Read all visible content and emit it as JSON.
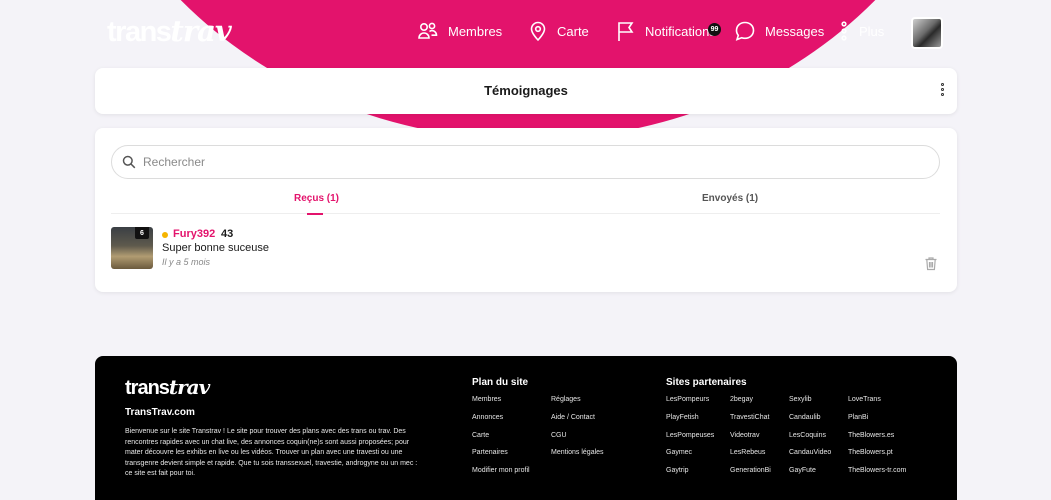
{
  "header": {
    "logo_a": "trans",
    "logo_b": "trav",
    "nav": {
      "members": "Membres",
      "map": "Carte",
      "notifications": "Notifications",
      "notifications_badge": "99",
      "messages": "Messages",
      "more": "Plus"
    }
  },
  "page": {
    "title": "Témoignages"
  },
  "search": {
    "placeholder": "Rechercher"
  },
  "tabs": {
    "received": "Reçus (1)",
    "sent": "Envoyés (1)"
  },
  "testimonial": {
    "photo_count": "6",
    "username": "Fury392",
    "age": "43",
    "message": "Super bonne suceuse",
    "time": "Il y a 5 mois",
    "status_color": "#f5b400"
  },
  "footer": {
    "logo_a": "trans",
    "logo_b": "trav",
    "site_name": "TransTrav.com",
    "description": "Bienvenue sur le site Transtrav ! Le site pour trouver des plans avec des trans ou trav. Des rencontres rapides avec un chat live, des annonces coquin(ne)s sont aussi proposées; pour mater découvre les exhibs en live ou les vidéos. Trouver un plan avec une travesti ou une transgenre devient simple et rapide. Que tu sois transsexuel, travestie, androgyne ou un mec : ce site est fait pour toi.",
    "sitemap_title": "Plan du site",
    "sitemap_col1": [
      "Membres",
      "Annonces",
      "Carte",
      "Partenaires",
      "Modifier mon profil"
    ],
    "sitemap_col2": [
      "Réglages",
      "Aide / Contact",
      "CGU",
      "Mentions légales"
    ],
    "partners_title": "Sites partenaires",
    "partners_col1": [
      "LesPompeurs",
      "PlayFetish",
      "LesPompeuses",
      "Gaymec",
      "Gaytrip"
    ],
    "partners_col2": [
      "2begay",
      "TravestiChat",
      "Videotrav",
      "LesRebeus",
      "GenerationBi"
    ],
    "partners_col3": [
      "Sexylib",
      "Candaulib",
      "LesCoquins",
      "CandauVideo",
      "GayFute"
    ],
    "partners_col4": [
      "LoveTrans",
      "PlanBi",
      "TheBlowers.es",
      "TheBlowers.pt",
      "TheBlowers-tr.com"
    ]
  },
  "colors": {
    "brand": "#e3136c",
    "footer_bg": "#000000",
    "page_bg": "#f4f3f8"
  }
}
